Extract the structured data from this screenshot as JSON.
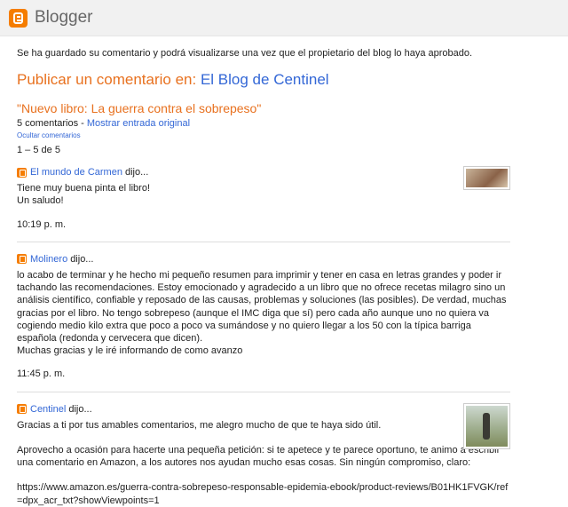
{
  "header": {
    "brand": "Blogger"
  },
  "notice": "Se ha guardado su comentario y podrá visualizarse una vez que el propietario del blog lo haya aprobado.",
  "publish": {
    "label": "Publicar un comentario en:",
    "blog_name": "El Blog de Centinel"
  },
  "post": {
    "title": "\"Nuevo libro: La guerra contra el sobrepeso\"",
    "comment_count": "5 comentarios",
    "separator": " - ",
    "show_original": "Mostrar entrada original",
    "hide_comments": "Ocultar comentarios",
    "pager": "1 – 5 de 5"
  },
  "comments": [
    {
      "author": "El mundo de Carmen",
      "said": "dijo...",
      "lines": [
        "Tiene muy buena pinta el libro!",
        "Un saludo!"
      ],
      "time": "10:19 p. m."
    },
    {
      "author": "Molinero",
      "said": "dijo...",
      "lines": [
        "lo acabo de terminar y he hecho mi pequeño resumen para imprimir y tener en casa en letras grandes y poder ir tachando las recomendaciones. Estoy emocionado y agradecido a un libro que no ofrece recetas milagro sino un análisis científico, confiable y reposado de las causas, problemas y soluciones (las posibles). De verdad, muchas gracias por el libro. No tengo sobrepeso (aunque el IMC diga que sí) pero cada año aunque uno no quiera va cogiendo medio kilo extra que poco a poco va sumándose y no quiero llegar a los 50 con la típica barriga española (redonda y cervecera que dicen).",
        "Muchas gracias y le iré informando de como avanzo"
      ],
      "time": "11:45 p. m."
    },
    {
      "author": "Centinel",
      "said": "dijo...",
      "lines": [
        "Gracias a ti por tus amables comentarios, me alegro mucho de que te haya sido útil.",
        "Aprovecho a ocasión para hacerte una pequeña petición: si te apetece y te parece oportuno, te animo a escribir una comentario en Amazon, a los autores nos ayudan mucho esas cosas. Sin ningún compromiso, claro:",
        "https://www.amazon.es/guerra-contra-sobrepeso-responsable-epidemia-ebook/product-reviews/B01HK1FVGK/ref=dpx_acr_txt?showViewpoints=1"
      ]
    }
  ]
}
